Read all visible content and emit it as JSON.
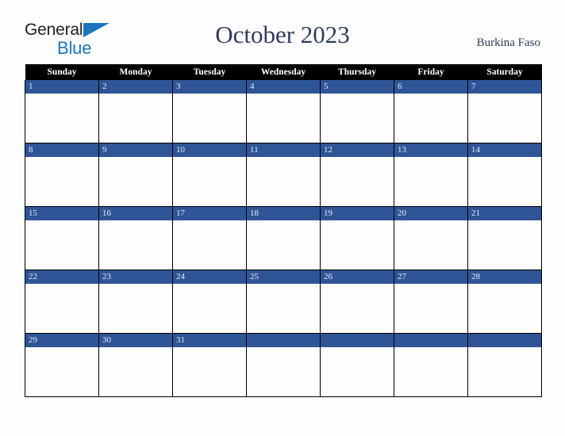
{
  "brand": {
    "word_one": "General",
    "word_two": "Blue",
    "color_dark": "#231f20",
    "color_blue": "#1b76bc"
  },
  "header": {
    "title": "October 2023",
    "location": "Burkina Faso",
    "title_color": "#2e3d5c"
  },
  "calendar": {
    "month": "October",
    "year": "2023",
    "header_background": "#000000",
    "header_text_color": "#ffffff",
    "day_band_color": "#2f5597",
    "day_number_color": "#e8ecf4",
    "cell_background": "#fdfdfd",
    "grid_line_color": "#000000",
    "weekday_headers": [
      "Sunday",
      "Monday",
      "Tuesday",
      "Wednesday",
      "Thursday",
      "Friday",
      "Saturday"
    ],
    "weeks": [
      [
        {
          "day": "1"
        },
        {
          "day": "2"
        },
        {
          "day": "3"
        },
        {
          "day": "4"
        },
        {
          "day": "5"
        },
        {
          "day": "6"
        },
        {
          "day": "7"
        }
      ],
      [
        {
          "day": "8"
        },
        {
          "day": "9"
        },
        {
          "day": "10"
        },
        {
          "day": "11"
        },
        {
          "day": "12"
        },
        {
          "day": "13"
        },
        {
          "day": "14"
        }
      ],
      [
        {
          "day": "15"
        },
        {
          "day": "16"
        },
        {
          "day": "17"
        },
        {
          "day": "18"
        },
        {
          "day": "19"
        },
        {
          "day": "20"
        },
        {
          "day": "21"
        }
      ],
      [
        {
          "day": "22"
        },
        {
          "day": "23"
        },
        {
          "day": "24"
        },
        {
          "day": "25"
        },
        {
          "day": "26"
        },
        {
          "day": "27"
        },
        {
          "day": "28"
        }
      ],
      [
        {
          "day": "29"
        },
        {
          "day": "30"
        },
        {
          "day": "31"
        },
        {
          "day": ""
        },
        {
          "day": ""
        },
        {
          "day": ""
        },
        {
          "day": ""
        }
      ]
    ]
  }
}
